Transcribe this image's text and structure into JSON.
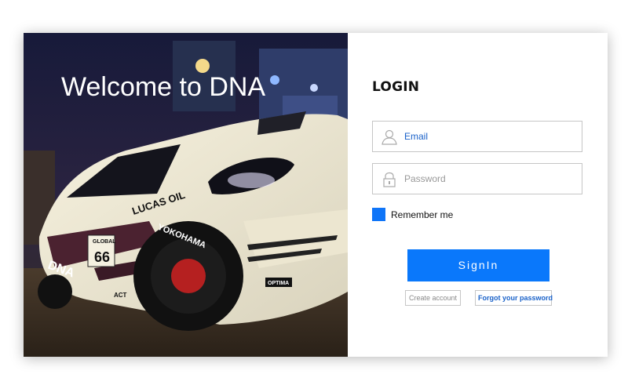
{
  "hero": {
    "welcome_text": "Welcome to DNA",
    "car_decals": {
      "sponsor": "LUCAS OIL",
      "tire": "YOKOHAMA",
      "number": "66",
      "brand": "DNA",
      "badge": "OPTIMA",
      "series": "GLOBAL",
      "act": "ACT"
    }
  },
  "login": {
    "title": "LOGIN",
    "email_placeholder": "Email",
    "password_placeholder": "Password",
    "remember_label": "Remember me",
    "remember_checked": true,
    "signin_label": "SignIn",
    "create_account_label": "Create account",
    "forgot_password_label": "Forgot your password"
  },
  "colors": {
    "accent": "#0a78fb",
    "link": "#1a62c9"
  },
  "icons": {
    "email_field": "user-icon",
    "password_field": "lock-icon"
  }
}
